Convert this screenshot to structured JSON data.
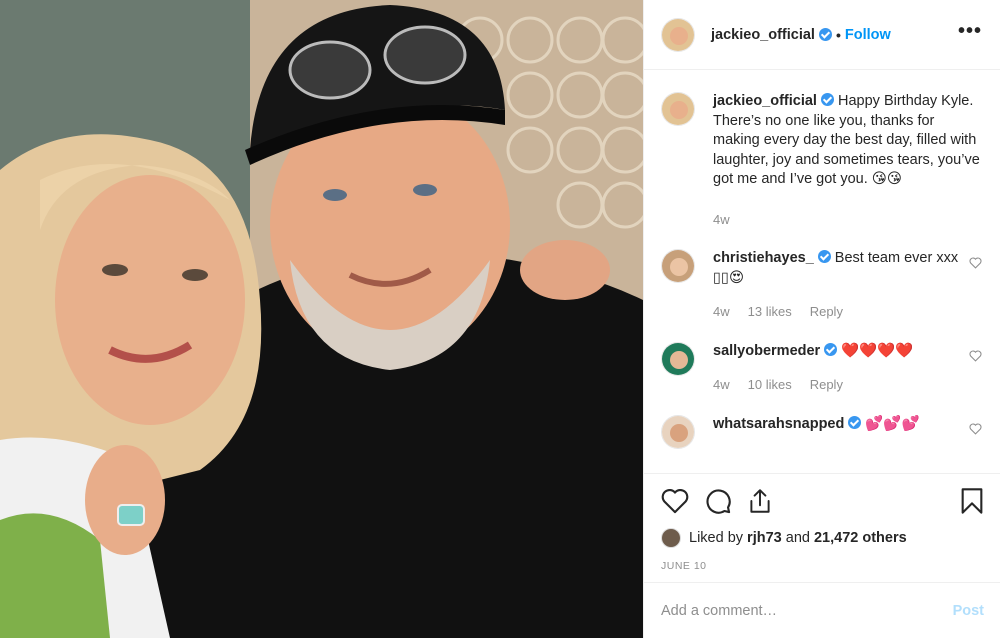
{
  "header": {
    "username": "jackieo_official",
    "separator": "•",
    "follow_label": "Follow",
    "more_label": "•••"
  },
  "caption": {
    "username": "jackieo_official",
    "text": "Happy Birthday Kyle. There’s no one like you, thanks for making every day the best day, filled with laughter, joy and sometimes tears, you’ve got me and I’ve got you. 😘😘",
    "age": "4w"
  },
  "comments": [
    {
      "username": "christiehayes_",
      "text": "Best team ever xxx ▯▯😍",
      "age": "4w",
      "likes": "13 likes",
      "reply": "Reply"
    },
    {
      "username": "sallyobermeder",
      "text": "❤️❤️❤️❤️",
      "age": "4w",
      "likes": "10 likes",
      "reply": "Reply"
    },
    {
      "username": "whatsarahsnapped",
      "text": "💕💕💕"
    }
  ],
  "likes": {
    "prefix": "Liked by",
    "first_user": "rjh73",
    "middle": "and",
    "others": "21,472 others"
  },
  "date": "JUNE 10",
  "add_comment": {
    "placeholder": "Add a comment…",
    "post_label": "Post"
  },
  "colors": {
    "link_blue": "#0095f6",
    "verified_blue": "#3897f0",
    "muted": "#8e8e8e"
  }
}
